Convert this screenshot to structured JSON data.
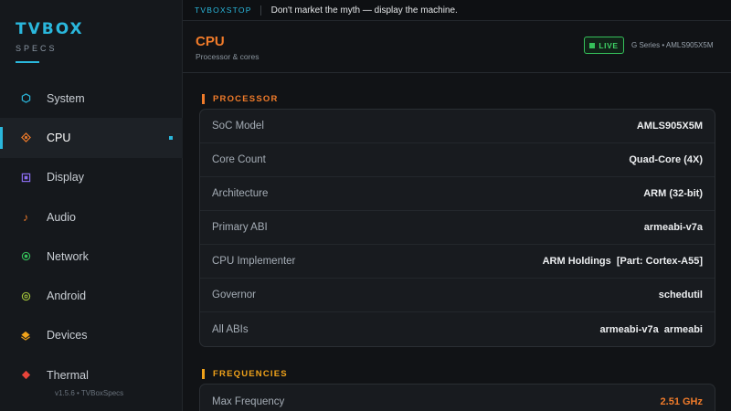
{
  "brand": {
    "title": "TVBOX",
    "subtitle": "SPECS"
  },
  "sidebar": {
    "items": [
      {
        "label": "System",
        "icon": "hexagon-icon",
        "color": "#2ab7dc",
        "active": false
      },
      {
        "label": "CPU",
        "icon": "chip-icon",
        "color": "#f07b2a",
        "active": true
      },
      {
        "label": "Display",
        "icon": "display-icon",
        "color": "#8b6cf0",
        "active": false
      },
      {
        "label": "Audio",
        "icon": "music-note-icon",
        "color": "#f07b2a",
        "active": false
      },
      {
        "label": "Network",
        "icon": "network-icon",
        "color": "#35c05a",
        "active": false
      },
      {
        "label": "Android",
        "icon": "android-icon",
        "color": "#a3c43a",
        "active": false
      },
      {
        "label": "Devices",
        "icon": "devices-icon",
        "color": "#f0a21a",
        "active": false
      },
      {
        "label": "Thermal",
        "icon": "thermal-icon",
        "color": "#e8443a",
        "active": false
      }
    ],
    "version": "v1.5.6 • TVBoxSpecs"
  },
  "topbar": {
    "tag": "TVBOXSTOP",
    "message": "Don't market the myth — display the machine."
  },
  "header": {
    "title": "CPU",
    "subtitle": "Processor & cores",
    "live_label": "LIVE",
    "series": "G Series • AMLS905X5M"
  },
  "processor": {
    "title": "PROCESSOR",
    "rows": [
      {
        "key": "SoC Model",
        "value": "AMLS905X5M"
      },
      {
        "key": "Core Count",
        "value": "Quad-Core (4X)"
      },
      {
        "key": "Architecture",
        "value": "ARM (32-bit)"
      },
      {
        "key": "Primary ABI",
        "value": "armeabi-v7a"
      },
      {
        "key": "CPU Implementer",
        "value": "ARM Holdings  [Part: Cortex-A55]"
      },
      {
        "key": "Governor",
        "value": "schedutil"
      },
      {
        "key": "All ABIs",
        "value": "armeabi-v7a  armeabi"
      }
    ]
  },
  "frequencies": {
    "title": "FREQUENCIES",
    "rows": [
      {
        "key": "Max Frequency",
        "value": "2.51 GHz"
      }
    ]
  },
  "colors": {
    "accent": "#2ab7dc",
    "orange": "#f07b2a",
    "green": "#35c05a",
    "amber": "#f0a21a"
  }
}
